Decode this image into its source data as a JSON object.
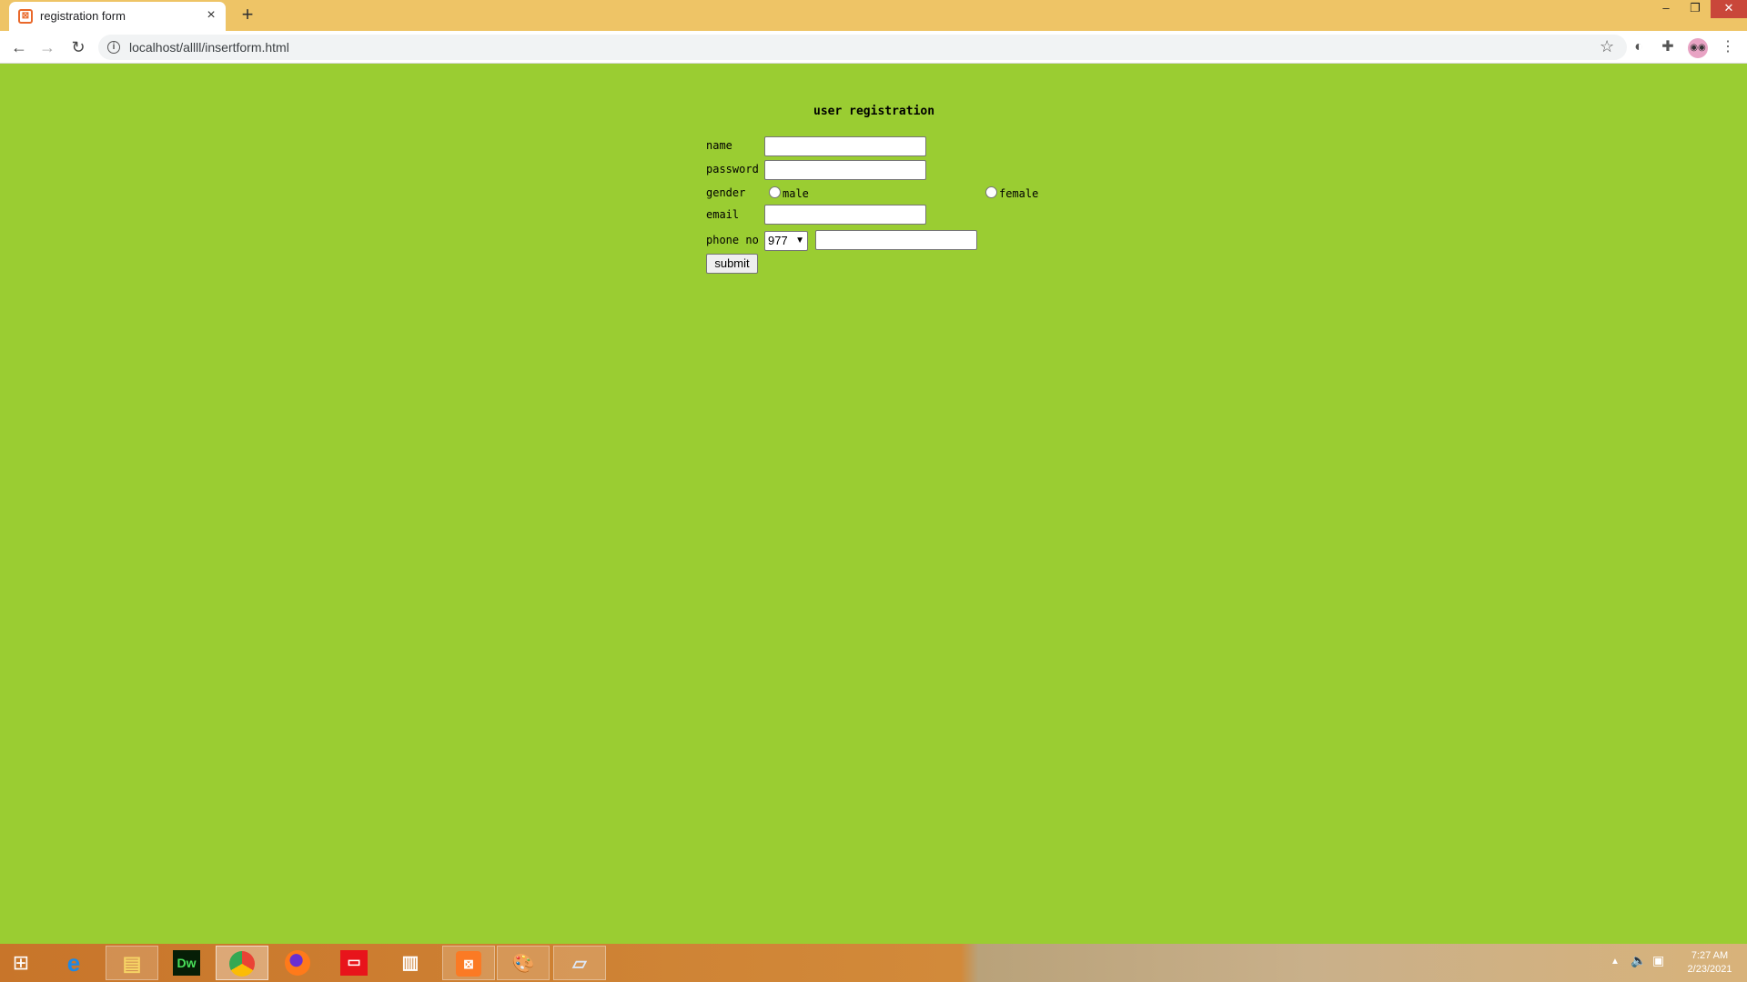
{
  "browser": {
    "tab_title": "registration form",
    "tab_close": "×",
    "new_tab": "+",
    "url": "localhost/allll/insertform.html",
    "win_minimize": "–",
    "win_maximize": "❐",
    "win_close": "✕",
    "back": "←",
    "forward": "→",
    "reload": "↻",
    "info": "i",
    "star": "☆",
    "menu": "⋮"
  },
  "form": {
    "title": "user registration",
    "labels": {
      "name": "name",
      "password": "password",
      "gender": "gender",
      "email": "email",
      "phone": "phone no"
    },
    "gender_options": [
      "male",
      "female"
    ],
    "country_code": "977",
    "submit_label": "submit"
  },
  "taskbar": {
    "time": "7:27 AM",
    "date": "2/23/2021",
    "items": [
      "start",
      "internet-explorer",
      "file-explorer",
      "dreamweaver",
      "chrome",
      "firefox",
      "oracle",
      "chart-app",
      "xampp",
      "paint",
      "notepad"
    ],
    "dw_label": "Dw"
  },
  "colors": {
    "page_background": "#9acd32",
    "tabbar": "#eec466"
  }
}
